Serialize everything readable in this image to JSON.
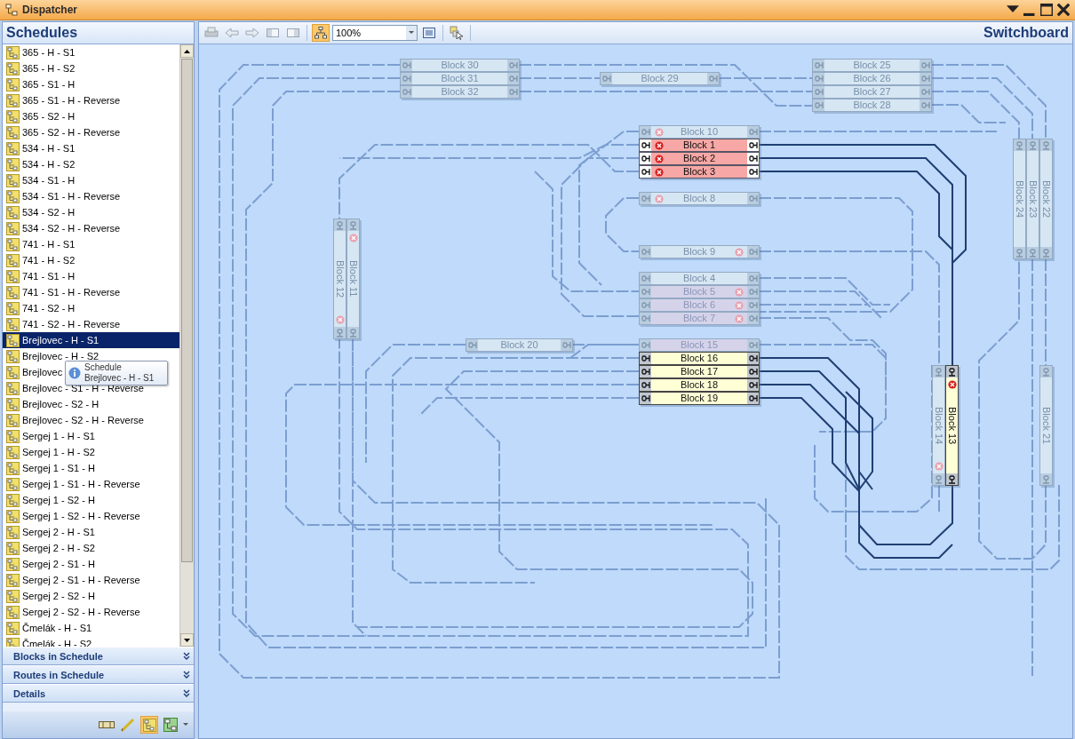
{
  "window": {
    "title": "Dispatcher"
  },
  "sidebar": {
    "title": "Schedules",
    "items": [
      {
        "label": "365 - H - S1",
        "selected": false
      },
      {
        "label": "365 - H - S2",
        "selected": false
      },
      {
        "label": "365 - S1 - H",
        "selected": false
      },
      {
        "label": "365 - S1 - H - Reverse",
        "selected": false
      },
      {
        "label": "365 - S2 - H",
        "selected": false
      },
      {
        "label": "365 - S2 - H - Reverse",
        "selected": false
      },
      {
        "label": "534 - H - S1",
        "selected": false
      },
      {
        "label": "534 - H - S2",
        "selected": false
      },
      {
        "label": "534 - S1 - H",
        "selected": false
      },
      {
        "label": "534 - S1 - H - Reverse",
        "selected": false
      },
      {
        "label": "534 - S2 - H",
        "selected": false
      },
      {
        "label": "534 - S2 - H - Reverse",
        "selected": false
      },
      {
        "label": "741 - H - S1",
        "selected": false
      },
      {
        "label": "741 - H - S2",
        "selected": false
      },
      {
        "label": "741 - S1 - H",
        "selected": false
      },
      {
        "label": "741 - S1 - H - Reverse",
        "selected": false
      },
      {
        "label": "741 - S2 - H",
        "selected": false
      },
      {
        "label": "741 - S2 - H - Reverse",
        "selected": false
      },
      {
        "label": "Brejlovec - H - S1",
        "selected": true
      },
      {
        "label": "Brejlovec - H - S2",
        "selected": false
      },
      {
        "label": "Brejlovec",
        "selected": false
      },
      {
        "label": "Brejlovec - S1 - H - Reverse",
        "selected": false
      },
      {
        "label": "Brejlovec - S2 - H",
        "selected": false
      },
      {
        "label": "Brejlovec - S2 - H - Reverse",
        "selected": false
      },
      {
        "label": "Sergej 1 - H - S1",
        "selected": false
      },
      {
        "label": "Sergej 1 - H - S2",
        "selected": false
      },
      {
        "label": "Sergej 1 - S1 - H",
        "selected": false
      },
      {
        "label": "Sergej 1 - S1 - H - Reverse",
        "selected": false
      },
      {
        "label": "Sergej 1 - S2 - H",
        "selected": false
      },
      {
        "label": "Sergej 1 - S2 - H - Reverse",
        "selected": false
      },
      {
        "label": "Sergej 2 - H - S1",
        "selected": false
      },
      {
        "label": "Sergej 2 - H - S2",
        "selected": false
      },
      {
        "label": "Sergej 2 - S1 - H",
        "selected": false
      },
      {
        "label": "Sergej 2 - S1 - H - Reverse",
        "selected": false
      },
      {
        "label": "Sergej 2 - S2 - H",
        "selected": false
      },
      {
        "label": "Sergej 2 - S2 - H - Reverse",
        "selected": false
      },
      {
        "label": "Čmelák - H - S1",
        "selected": false
      },
      {
        "label": "Čmelák - H - S2",
        "selected": false
      }
    ],
    "tooltip": {
      "title": "Schedule",
      "text": "Brejlovec - H - S1"
    },
    "sections": [
      "Blocks in Schedule",
      "Routes in Schedule",
      "Details"
    ]
  },
  "toolbar": {
    "zoom": "100%",
    "title": "Switchboard"
  },
  "blocks": [
    {
      "label": "Block 30",
      "kind": "idle",
      "error": false
    },
    {
      "label": "Block 31",
      "kind": "idle",
      "error": false
    },
    {
      "label": "Block 32",
      "kind": "idle",
      "error": false
    },
    {
      "label": "Block 29",
      "kind": "idle",
      "error": false
    },
    {
      "label": "Block 25",
      "kind": "idle",
      "error": false
    },
    {
      "label": "Block 26",
      "kind": "idle",
      "error": false
    },
    {
      "label": "Block 27",
      "kind": "idle",
      "error": false
    },
    {
      "label": "Block 28",
      "kind": "idle",
      "error": false
    },
    {
      "label": "Block 10",
      "kind": "idle",
      "error": true
    },
    {
      "label": "Block 1",
      "kind": "occupied",
      "error": true
    },
    {
      "label": "Block 2",
      "kind": "occupied",
      "error": true
    },
    {
      "label": "Block 3",
      "kind": "occupied",
      "error": true
    },
    {
      "label": "Block 24",
      "kind": "idle",
      "error": false
    },
    {
      "label": "Block 23",
      "kind": "idle",
      "error": false
    },
    {
      "label": "Block 22",
      "kind": "idle",
      "error": false
    },
    {
      "label": "Block 8",
      "kind": "idle",
      "error": true
    },
    {
      "label": "Block 12",
      "kind": "idle",
      "error": true
    },
    {
      "label": "Block 11",
      "kind": "idle",
      "error": true
    },
    {
      "label": "Block 9",
      "kind": "idle",
      "error": true
    },
    {
      "label": "Block 4",
      "kind": "idle",
      "error": false
    },
    {
      "label": "Block 5",
      "kind": "disabled",
      "error": true
    },
    {
      "label": "Block 6",
      "kind": "disabled",
      "error": true
    },
    {
      "label": "Block 7",
      "kind": "disabled",
      "error": true
    },
    {
      "label": "Block 20",
      "kind": "idle",
      "error": false
    },
    {
      "label": "Block 15",
      "kind": "disabled",
      "error": false
    },
    {
      "label": "Block 16",
      "kind": "route",
      "error": false
    },
    {
      "label": "Block 17",
      "kind": "route",
      "error": false
    },
    {
      "label": "Block 18",
      "kind": "route",
      "error": false
    },
    {
      "label": "Block 19",
      "kind": "route",
      "error": false
    },
    {
      "label": "Block 14",
      "kind": "idle",
      "error": true
    },
    {
      "label": "Block 13",
      "kind": "route",
      "error": true
    },
    {
      "label": "Block 21",
      "kind": "idle",
      "error": false
    }
  ]
}
